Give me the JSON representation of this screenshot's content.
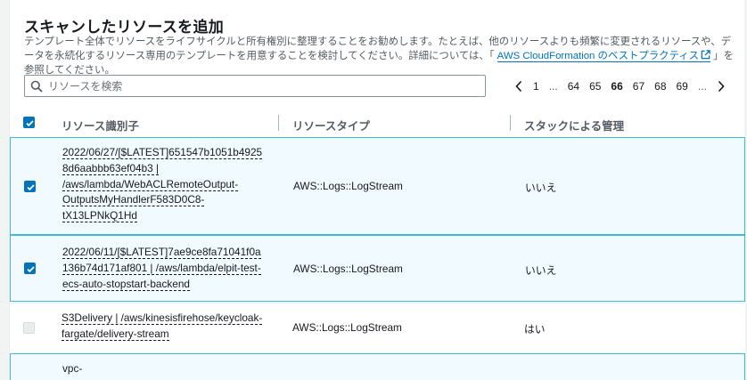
{
  "page": {
    "title": "スキャンしたリソースを追加",
    "description_before": "テンプレート全体でリソースをライフサイクルと所有権別に整理することをお勧めします。たとえば、他のリソースよりも頻繁に変更されるリソースや、データを永続化するリソース専用のテンプレートを用意することを検討してください。詳細については、「 ",
    "description_link": "AWS CloudFormation のベストプラクティス",
    "description_after": " 」を参照してください。"
  },
  "search": {
    "placeholder": "リソースを検索",
    "value": ""
  },
  "pagination": {
    "pages": [
      "1",
      "...",
      "64",
      "65",
      "66",
      "67",
      "68",
      "69",
      "..."
    ],
    "current": "66"
  },
  "table": {
    "columns": [
      "リソース識別子",
      "リソースタイプ",
      "スタックによる管理"
    ],
    "rows": [
      {
        "id_lines": [
          "2022/06/27/[$LATEST]651547b1051b4925",
          "8d6aabbb63ef04b3 |",
          "/aws/lambda/WebACLRemoteOutput-",
          "OutputsMyHandlerF583D0C8-",
          "tX13LPNkQ1Hd"
        ],
        "type": "AWS::Logs::LogStream",
        "managed": "いいえ",
        "state": "checked"
      },
      {
        "id_lines": [
          "2022/06/11/[$LATEST]7ae9ce8fa71041f0a",
          "136b74d171af801 | /aws/lambda/elpit-test-",
          "ecs-auto-stopstart-backend"
        ],
        "type": "AWS::Logs::LogStream",
        "managed": "いいえ",
        "state": "checked"
      },
      {
        "id_lines": [
          "S3Delivery | /aws/kinesisfirehose/keycloak-",
          "fargate/delivery-stream"
        ],
        "type": "AWS::Logs::LogStream",
        "managed": "はい",
        "state": "disabled"
      },
      {
        "id_lines": [
          "vpc-"
        ],
        "type": "",
        "managed": "",
        "state": "checked"
      }
    ]
  },
  "colors": {
    "accent": "#0073bb",
    "selected_bg": "#f1faff",
    "selected_border": "#44b9d6"
  }
}
